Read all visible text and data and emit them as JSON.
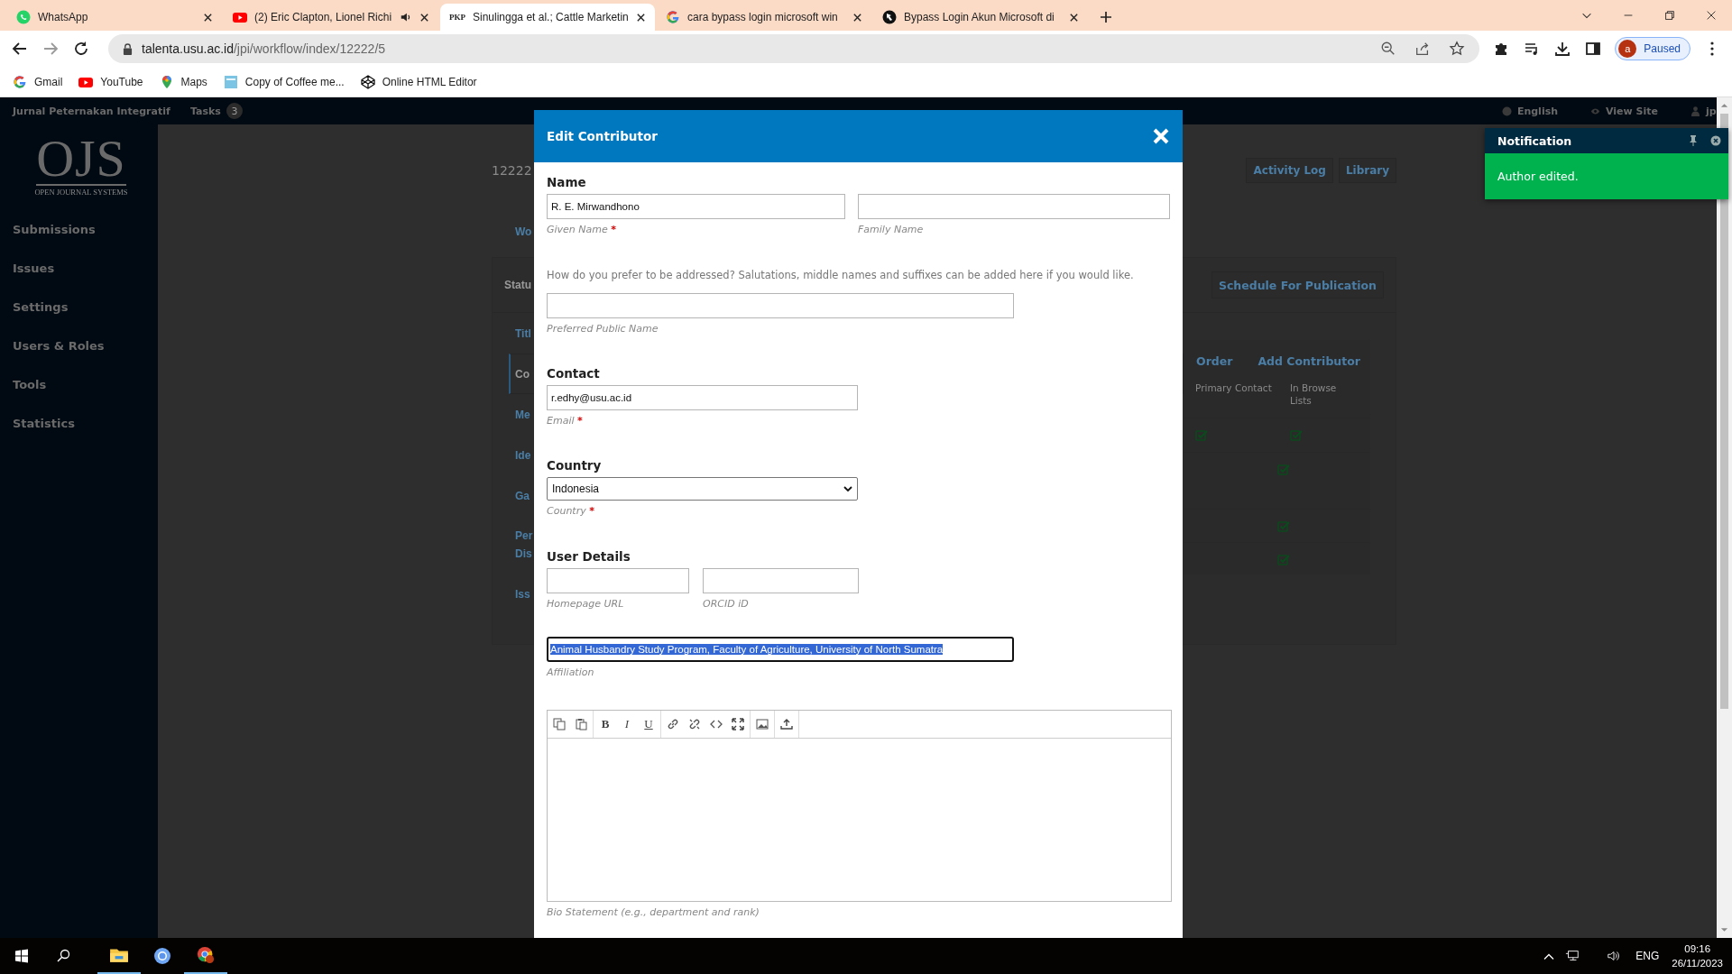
{
  "browser": {
    "tabs": [
      {
        "title": "WhatsApp",
        "kind": "whatsapp",
        "selected": false
      },
      {
        "title": "(2) Eric Clapton, Lionel Richi",
        "kind": "youtube",
        "audio": true,
        "selected": false
      },
      {
        "title": "Sinulingga et al.; Cattle Marketin",
        "kind": "text",
        "icon_text": "PKP",
        "selected": true
      },
      {
        "title": "cara bypass login microsoft win",
        "kind": "google",
        "selected": false
      },
      {
        "title": "Bypass Login Akun Microsoft di",
        "kind": "dark",
        "selected": false
      }
    ],
    "forward_disabled": true,
    "url": {
      "host": "talenta.usu.ac.id",
      "path": "/jpi/workflow/index/12222/5"
    },
    "profile": {
      "initial": "a",
      "status": "Paused"
    },
    "bookmarks": [
      {
        "label": "Gmail",
        "kind": "google"
      },
      {
        "label": "YouTube",
        "kind": "youtube"
      },
      {
        "label": "Maps",
        "kind": "pin"
      },
      {
        "label": "Copy of Coffee me...",
        "kind": "square"
      },
      {
        "label": "Online HTML Editor",
        "kind": "cube"
      }
    ]
  },
  "ojs": {
    "journal": "Jurnal Peternakan Integratif",
    "tasks_label": "Tasks",
    "tasks_count": "3",
    "language": "English",
    "view_site": "View Site",
    "user": "jp",
    "logo": {
      "mark": "OJS",
      "subtitle": "OPEN JOURNAL SYSTEMS"
    },
    "nav": [
      "Submissions",
      "Issues",
      "Settings",
      "Users & Roles",
      "Tools",
      "Statistics"
    ],
    "submission_id": "12222",
    "header_buttons": [
      "Activity Log",
      "Library"
    ],
    "stage_tab": "Wo",
    "status_label": "Statu",
    "schedule_button": "Schedule For Publication",
    "publication_menu": [
      {
        "label": "Titl",
        "selected": false
      },
      {
        "label": "Co",
        "selected": true
      },
      {
        "label": "Me",
        "selected": false
      },
      {
        "label": "Ide",
        "selected": false
      },
      {
        "label": "Ga",
        "selected": false
      },
      {
        "label": "Per\nDis",
        "selected": false
      },
      {
        "label": "Iss",
        "selected": false
      }
    ],
    "contributors": {
      "actions": [
        "Order",
        "Add Contributor"
      ],
      "columns": [
        "Primary Contact",
        "In Browse Lists"
      ],
      "rows": [
        {
          "primary_contact": true,
          "in_browse_lists": true
        },
        {
          "primary_contact": false,
          "in_browse_lists": true
        },
        {
          "primary_contact": false,
          "in_browse_lists": true
        },
        {
          "primary_contact": false,
          "in_browse_lists": true
        }
      ]
    }
  },
  "modal": {
    "title": "Edit Contributor",
    "name_heading": "Name",
    "given_name": {
      "value": "R. E. Mirwandhono",
      "label": "Given Name",
      "required_mark": "*"
    },
    "family_name": {
      "label": "Family Name"
    },
    "hint": "How do you prefer to be addressed? Salutations, middle names and suffixes can be added here if you would like.",
    "preferred_name": {
      "label": "Preferred Public Name"
    },
    "contact_heading": "Contact",
    "email": {
      "value": "r.edhy@usu.ac.id",
      "label": "Email",
      "required_mark": "*"
    },
    "country_heading": "Country",
    "country": {
      "value": "Indonesia",
      "label": "Country",
      "required_mark": "*"
    },
    "details_heading": "User Details",
    "homepage": {
      "label": "Homepage URL"
    },
    "orcid": {
      "label": "ORCID iD"
    },
    "affiliation": {
      "value": "Animal Husbandry Study Program, Faculty of Agriculture, University of North Sumatra",
      "label": "Affiliation",
      "text_selected": true
    },
    "bio": {
      "label": "Bio Statement (e.g., department and rank)",
      "format_buttons": [
        {
          "glyph": "B",
          "kind": "bold"
        },
        {
          "glyph": "I",
          "kind": "italic"
        },
        {
          "glyph": "U",
          "kind": "underline"
        }
      ]
    }
  },
  "notification": {
    "title": "Notification",
    "message": "Author edited."
  },
  "taskbar": {
    "language": "ENG",
    "time": "09:16",
    "date": "26/11/2023"
  }
}
